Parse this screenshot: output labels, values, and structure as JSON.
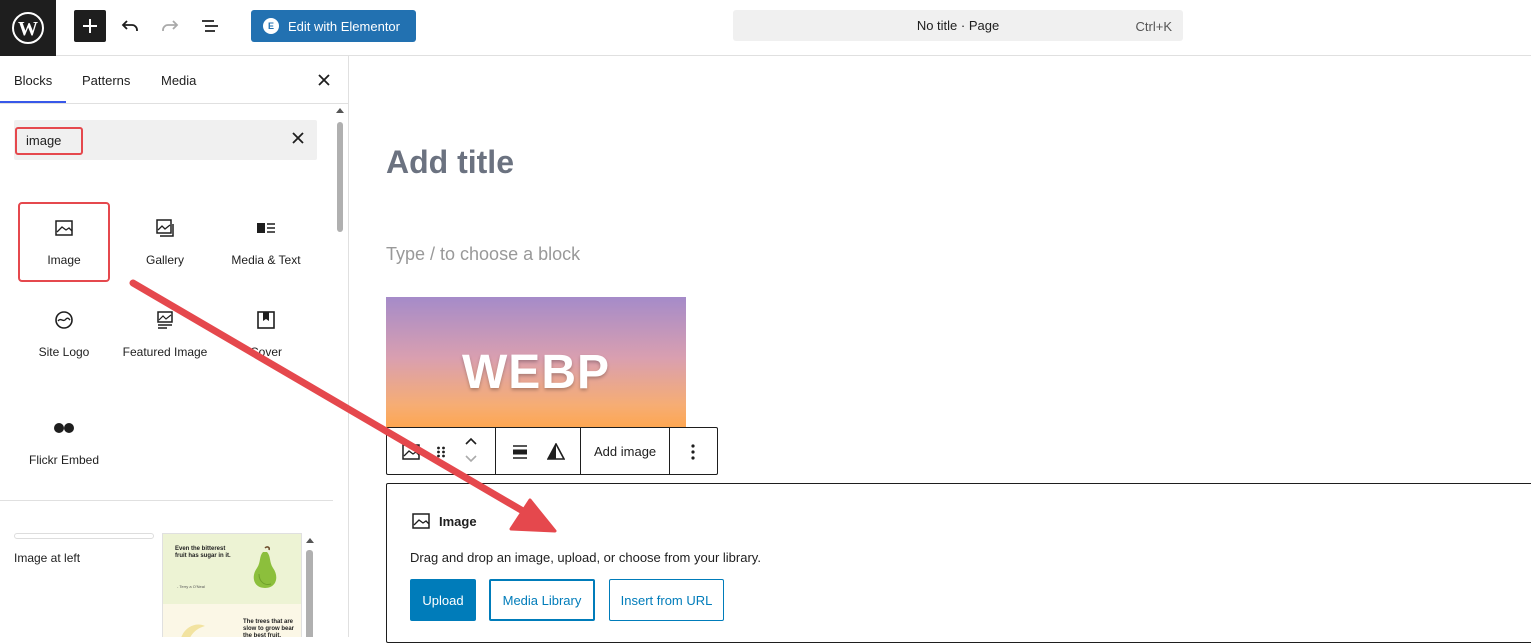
{
  "topbar": {
    "elementor_label": "Edit with Elementor",
    "command_title": "No title · Page",
    "command_shortcut": "Ctrl+K"
  },
  "sidebar": {
    "tabs": [
      "Blocks",
      "Patterns",
      "Media"
    ],
    "active_tab": "Blocks",
    "search_value": "image",
    "blocks": [
      {
        "label": "Image",
        "icon": "image-icon"
      },
      {
        "label": "Gallery",
        "icon": "gallery-icon"
      },
      {
        "label": "Media & Text",
        "icon": "media-text-icon"
      },
      {
        "label": "Site Logo",
        "icon": "site-logo-icon"
      },
      {
        "label": "Featured Image",
        "icon": "featured-image-icon"
      },
      {
        "label": "Cover",
        "icon": "cover-icon"
      },
      {
        "label": "Flickr Embed",
        "icon": "flickr-icon"
      }
    ],
    "pattern": {
      "label": "Image at left",
      "preview_heading": "Even the bitterest fruit has sugar in it.",
      "preview_caption": "- Terry a O'Neal",
      "preview_heading2": "The trees that are slow to grow bear the best fruit."
    }
  },
  "canvas": {
    "title_placeholder": "Add title",
    "block_hint": "Type / to choose a block",
    "image_text": "WEBP",
    "toolbar_add_image": "Add image",
    "placeholder": {
      "title": "Image",
      "instructions": "Drag and drop an image, upload, or choose from your library.",
      "upload": "Upload",
      "media_library": "Media Library",
      "insert_url": "Insert from URL"
    }
  },
  "colors": {
    "accent": "#2271b1",
    "button_primary": "#007cba",
    "highlight": "#e5484d",
    "tab_indicator": "#3858e9"
  }
}
